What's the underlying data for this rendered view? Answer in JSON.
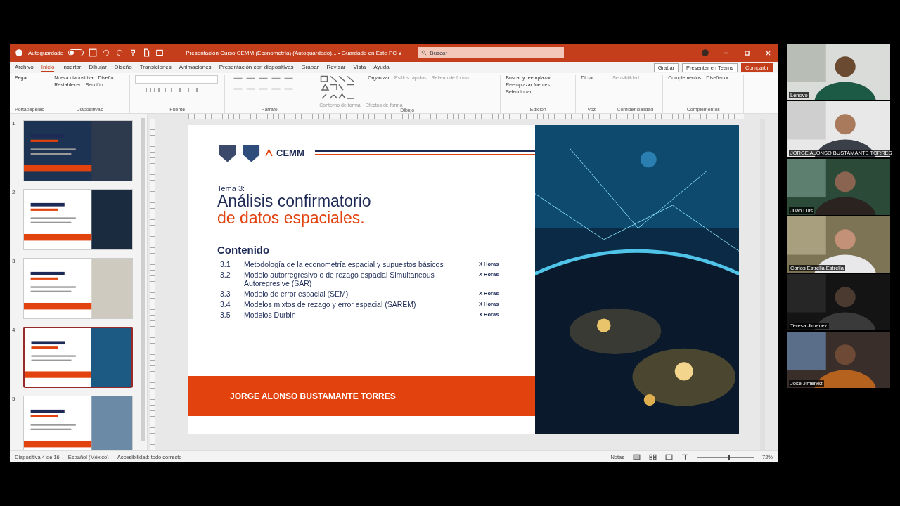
{
  "window": {
    "autosave_label": "Autoguardado",
    "autosave_on": false,
    "title": "Presentación Curso CEMM (Econometría) (Autoguardado)... • Guardado en Este PC ∨",
    "search": {
      "placeholder": "Buscar"
    }
  },
  "menu_tabs": [
    {
      "label": "Archivo",
      "selected": false
    },
    {
      "label": "Inicio",
      "selected": true
    },
    {
      "label": "Insertar",
      "selected": false
    },
    {
      "label": "Dibujar",
      "selected": false
    },
    {
      "label": "Diseño",
      "selected": false
    },
    {
      "label": "Transiciones",
      "selected": false
    },
    {
      "label": "Animaciones",
      "selected": false
    },
    {
      "label": "Presentación con diapositivas",
      "selected": false
    },
    {
      "label": "Grabar",
      "selected": false
    },
    {
      "label": "Revisar",
      "selected": false
    },
    {
      "label": "Vista",
      "selected": false
    },
    {
      "label": "Ayuda",
      "selected": false
    }
  ],
  "top_buttons": [
    {
      "label": "Grabar",
      "kind": "plain"
    },
    {
      "label": "Presentar en Teams",
      "kind": "plain"
    },
    {
      "label": "Compartir",
      "kind": "primary"
    }
  ],
  "ribbon_groups": [
    {
      "label": "Portapapeles",
      "items": [
        {
          "label": "Pegar",
          "disabled": false
        }
      ]
    },
    {
      "label": "Diapositivas",
      "items": [
        {
          "label": "Nueva diapositiva",
          "disabled": false
        },
        {
          "label": "Diseño",
          "disabled": false
        },
        {
          "label": "Restablecer",
          "disabled": false
        },
        {
          "label": "Sección",
          "disabled": false
        }
      ]
    },
    {
      "label": "Fuente"
    },
    {
      "label": "Párrafo"
    },
    {
      "label": "Dibujo",
      "items": [
        {
          "label": "Organizar",
          "disabled": false
        },
        {
          "label": "Estilos rápidos",
          "disabled": true
        },
        {
          "label": "Relleno de forma",
          "disabled": true
        },
        {
          "label": "Contorno de forma",
          "disabled": true
        },
        {
          "label": "Efectos de forma",
          "disabled": true
        }
      ]
    },
    {
      "label": "Edición",
      "items": [
        {
          "label": "Buscar y reemplazar",
          "disabled": false
        },
        {
          "label": "Reemplazar fuentes",
          "disabled": false
        },
        {
          "label": "Seleccionar",
          "disabled": false
        }
      ]
    },
    {
      "label": "Voz",
      "items": [
        {
          "label": "Dictar",
          "disabled": false
        }
      ]
    },
    {
      "label": "Confidencialidad",
      "items": [
        {
          "label": "Sensibilidad",
          "disabled": true
        }
      ]
    },
    {
      "label": "Complementos",
      "items": [
        {
          "label": "Complementos",
          "disabled": false
        },
        {
          "label": "Diseñador",
          "disabled": false
        }
      ]
    }
  ],
  "thumbnails": [
    {
      "number": "1",
      "selected": false
    },
    {
      "number": "2",
      "selected": false
    },
    {
      "number": "3",
      "selected": false
    },
    {
      "number": "4",
      "selected": true
    },
    {
      "number": "5",
      "selected": false
    }
  ],
  "slide": {
    "logo_text": "CEMM",
    "topic": "Tema 3:",
    "title_line1": "Análisis confirmatorio",
    "title_line2": "de datos espaciales.",
    "contents_heading": "Contenido",
    "items": [
      {
        "number": "3.1",
        "text": "Metodología de la econometría espacial y supuestos básicos",
        "hours": "X Horas"
      },
      {
        "number": "3.2",
        "text": "Modelo autorregresivo o de rezago espacial Simultaneous Autoregresive (SAR)",
        "hours": "X Horas"
      },
      {
        "number": "3.3",
        "text": "Modelo de error espacial (SEM)",
        "hours": "X Horas"
      },
      {
        "number": "3.4",
        "text": "Modelos mixtos de rezago y error espacial (SAREM)",
        "hours": "X Horas"
      },
      {
        "number": "3.5",
        "text": "Modelos Durbin",
        "hours": "X Horas"
      }
    ],
    "presenter": "JORGE ALONSO BUSTAMANTE TORRES"
  },
  "status_bar": {
    "slide_count": "Diapositiva 4 de 16",
    "language": "Español (México)",
    "accessibility": "Accesibilidad: todo correcto",
    "notes": "Notas",
    "zoom": "72%",
    "zoom_slider": {
      "level": 0.55
    }
  },
  "participants": [
    {
      "name": "Lenovo"
    },
    {
      "name": "JORGE ALONSO BUSTAMANTE TORRES"
    },
    {
      "name": "Juan Luis"
    },
    {
      "name": "Carlos Estrella Estrella"
    },
    {
      "name": "Teresa Jimenez"
    },
    {
      "name": "José Jimenez"
    }
  ]
}
